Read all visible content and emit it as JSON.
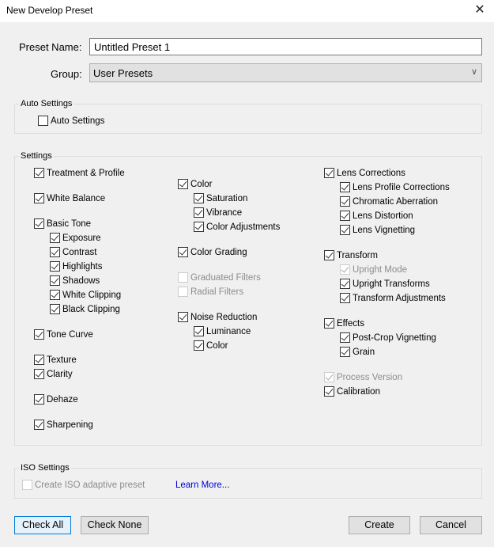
{
  "window": {
    "title": "New Develop Preset",
    "close_icon": "close-icon"
  },
  "form": {
    "preset_name_label": "Preset Name:",
    "preset_name_value": "Untitled Preset 1",
    "group_label": "Group:",
    "group_value": "User Presets"
  },
  "auto_settings": {
    "title": "Auto Settings",
    "checkbox": {
      "label": "Auto Settings",
      "checked": false,
      "disabled": false
    }
  },
  "settings": {
    "title": "Settings",
    "items": [
      {
        "label": "Treatment & Profile",
        "checked": true,
        "disabled": false
      },
      {
        "label": "White Balance",
        "checked": true,
        "disabled": false
      },
      {
        "label": "Basic Tone",
        "checked": true,
        "disabled": false
      },
      {
        "label": "Exposure",
        "checked": true,
        "disabled": false
      },
      {
        "label": "Contrast",
        "checked": true,
        "disabled": false
      },
      {
        "label": "Highlights",
        "checked": true,
        "disabled": false
      },
      {
        "label": "Shadows",
        "checked": true,
        "disabled": false
      },
      {
        "label": "White Clipping",
        "checked": true,
        "disabled": false
      },
      {
        "label": "Black Clipping",
        "checked": true,
        "disabled": false
      },
      {
        "label": "Tone Curve",
        "checked": true,
        "disabled": false
      },
      {
        "label": "Texture",
        "checked": true,
        "disabled": false
      },
      {
        "label": "Clarity",
        "checked": true,
        "disabled": false
      },
      {
        "label": "Dehaze",
        "checked": true,
        "disabled": false
      },
      {
        "label": "Sharpening",
        "checked": true,
        "disabled": false
      },
      {
        "label": "Color",
        "checked": true,
        "disabled": false
      },
      {
        "label": "Saturation",
        "checked": true,
        "disabled": false
      },
      {
        "label": "Vibrance",
        "checked": true,
        "disabled": false
      },
      {
        "label": "Color Adjustments",
        "checked": true,
        "disabled": false
      },
      {
        "label": "Color Grading",
        "checked": true,
        "disabled": false
      },
      {
        "label": "Graduated Filters",
        "checked": false,
        "disabled": true
      },
      {
        "label": "Radial Filters",
        "checked": false,
        "disabled": true
      },
      {
        "label": "Noise Reduction",
        "checked": true,
        "disabled": false
      },
      {
        "label": "Luminance",
        "checked": true,
        "disabled": false
      },
      {
        "label": "Color",
        "checked": true,
        "disabled": false
      },
      {
        "label": "Lens Corrections",
        "checked": true,
        "disabled": false
      },
      {
        "label": "Lens Profile Corrections",
        "checked": true,
        "disabled": false
      },
      {
        "label": "Chromatic Aberration",
        "checked": true,
        "disabled": false
      },
      {
        "label": "Lens Distortion",
        "checked": true,
        "disabled": false
      },
      {
        "label": "Lens Vignetting",
        "checked": true,
        "disabled": false
      },
      {
        "label": "Transform",
        "checked": true,
        "disabled": false
      },
      {
        "label": "Upright Mode",
        "checked": true,
        "disabled": true
      },
      {
        "label": "Upright Transforms",
        "checked": true,
        "disabled": false
      },
      {
        "label": "Transform Adjustments",
        "checked": true,
        "disabled": false
      },
      {
        "label": "Effects",
        "checked": true,
        "disabled": false
      },
      {
        "label": "Post-Crop Vignetting",
        "checked": true,
        "disabled": false
      },
      {
        "label": "Grain",
        "checked": true,
        "disabled": false
      },
      {
        "label": "Process Version",
        "checked": true,
        "disabled": true
      },
      {
        "label": "Calibration",
        "checked": true,
        "disabled": false
      }
    ]
  },
  "iso_settings": {
    "title": "ISO Settings",
    "checkbox": {
      "label": "Create ISO adaptive preset",
      "checked": false,
      "disabled": true
    },
    "learn_more": "Learn More..."
  },
  "buttons": {
    "check_all": "Check All",
    "check_none": "Check None",
    "create": "Create",
    "cancel": "Cancel"
  },
  "colors": {
    "link": "#0000d8",
    "focus_border": "#0078d7"
  }
}
